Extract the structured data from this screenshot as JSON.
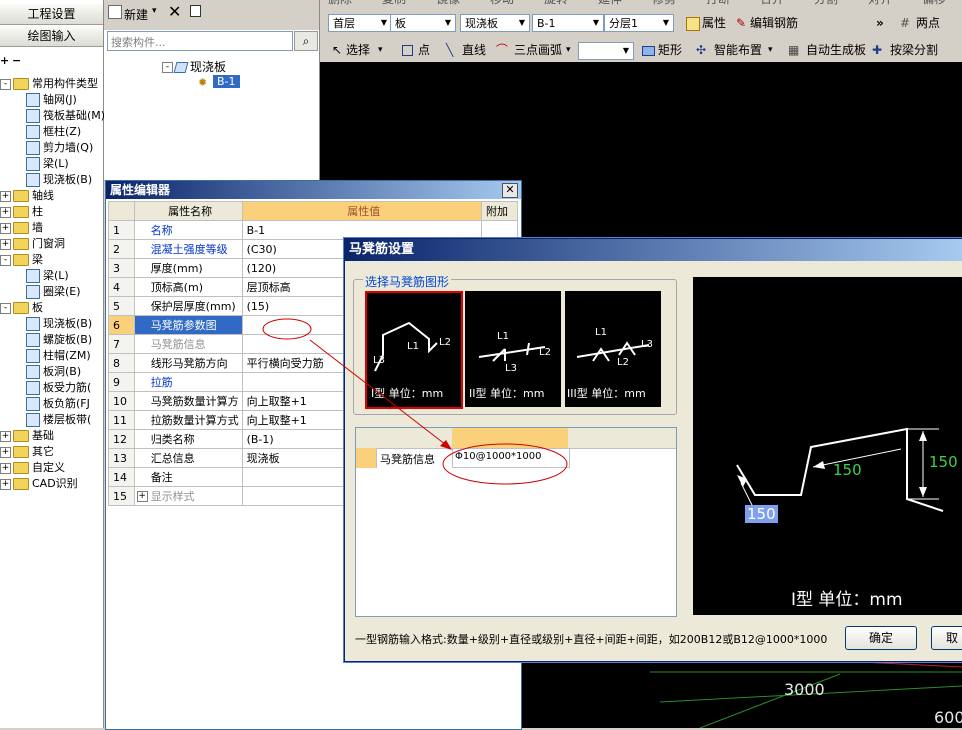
{
  "leftnav": {
    "btn_project": "工程设置",
    "btn_draw": "绘图输入",
    "tree": [
      {
        "label": "常用构件类型",
        "level": 0,
        "toggle": "-",
        "kind": "folder-open"
      },
      {
        "label": "轴网(J)",
        "level": 1,
        "kind": "grid-icon"
      },
      {
        "label": "筏板基础(M)",
        "level": 1,
        "kind": "raft-icon"
      },
      {
        "label": "框柱(Z)",
        "level": 1,
        "kind": "column-icon"
      },
      {
        "label": "剪力墙(Q)",
        "level": 1,
        "kind": "wall-icon"
      },
      {
        "label": "梁(L)",
        "level": 1,
        "kind": "beam-icon"
      },
      {
        "label": "现浇板(B)",
        "level": 1,
        "kind": "slab-icon"
      },
      {
        "label": "轴线",
        "level": 0,
        "toggle": "+",
        "kind": "folder"
      },
      {
        "label": "柱",
        "level": 0,
        "toggle": "+",
        "kind": "folder"
      },
      {
        "label": "墙",
        "level": 0,
        "toggle": "+",
        "kind": "folder"
      },
      {
        "label": "门窗洞",
        "level": 0,
        "toggle": "+",
        "kind": "folder"
      },
      {
        "label": "梁",
        "level": 0,
        "toggle": "-",
        "kind": "folder-open"
      },
      {
        "label": "梁(L)",
        "level": 1,
        "kind": "beam-icon"
      },
      {
        "label": "圈梁(E)",
        "level": 1,
        "kind": "ring-beam-icon"
      },
      {
        "label": "板",
        "level": 0,
        "toggle": "-",
        "kind": "folder-open"
      },
      {
        "label": "现浇板(B)",
        "level": 1,
        "kind": "slab-icon"
      },
      {
        "label": "螺旋板(B)",
        "level": 1,
        "kind": "spiral-slab-icon"
      },
      {
        "label": "柱帽(ZM)",
        "level": 1,
        "kind": "column-cap-icon"
      },
      {
        "label": "板洞(B)",
        "level": 1,
        "kind": "slab-hole-icon"
      },
      {
        "label": "板受力筋(",
        "level": 1,
        "kind": "rebar-icon"
      },
      {
        "label": "板负筋(FJ",
        "level": 1,
        "kind": "neg-rebar-icon"
      },
      {
        "label": "楼层板带(",
        "level": 1,
        "kind": "strip-icon"
      },
      {
        "label": "基础",
        "level": 0,
        "toggle": "+",
        "kind": "folder"
      },
      {
        "label": "其它",
        "level": 0,
        "toggle": "+",
        "kind": "folder"
      },
      {
        "label": "自定义",
        "level": 0,
        "toggle": "+",
        "kind": "folder"
      },
      {
        "label": "CAD识别",
        "level": 0,
        "toggle": "+",
        "kind": "folder"
      }
    ]
  },
  "complist": {
    "new_label": "新建",
    "search_placeholder": "搜索构件...",
    "tree_root": "现浇板",
    "tree_child": "B-1"
  },
  "toolbar": {
    "row0": [
      "删除",
      "复制",
      "镜像",
      "移动",
      "旋转",
      "延伸",
      "修剪",
      "打断",
      "合并",
      "分割",
      "对齐",
      "偏移"
    ],
    "floor": "首层",
    "cat": "板",
    "type": "现浇板",
    "name": "B-1",
    "layer": "分层1",
    "attr_btn": "属性",
    "edit_rebar_btn": "编辑钢筋",
    "two_point": "两点",
    "select_btn": "选择",
    "point_btn": "点",
    "line_btn": "直线",
    "arc_btn": "三点画弧",
    "rect_btn": "矩形",
    "smart_btn": "智能布置",
    "auto_btn": "自动生成板",
    "split_btn": "按梁分割"
  },
  "canvas": {
    "label_3000": "3000",
    "label_600": "600"
  },
  "propwin": {
    "title": "属性编辑器",
    "col_name": "属性名称",
    "col_value": "属性值",
    "col_extra": "附加",
    "rows": [
      {
        "n": "1",
        "name": "名称",
        "value": "B-1",
        "blue": true
      },
      {
        "n": "2",
        "name": "混凝土强度等级",
        "value": "(C30)",
        "blue": true
      },
      {
        "n": "3",
        "name": "厚度(mm)",
        "value": "(120)",
        "blue": false
      },
      {
        "n": "4",
        "name": "顶标高(m)",
        "value": "层顶标高",
        "blue": false
      },
      {
        "n": "5",
        "name": "保护层厚度(mm)",
        "value": "(15)",
        "blue": false
      },
      {
        "n": "6",
        "name": "马凳筋参数图",
        "value": "",
        "blue": false,
        "selected": true
      },
      {
        "n": "7",
        "name": "马凳筋信息",
        "value": "",
        "blue": false,
        "grey": true
      },
      {
        "n": "8",
        "name": "线形马凳筋方向",
        "value": "平行横向受力筋",
        "blue": false
      },
      {
        "n": "9",
        "name": "拉筋",
        "value": "",
        "blue": true
      },
      {
        "n": "10",
        "name": "马凳筋数量计算方",
        "value": "向上取整+1",
        "blue": false
      },
      {
        "n": "11",
        "name": "拉筋数量计算方式",
        "value": "向上取整+1",
        "blue": false
      },
      {
        "n": "12",
        "name": "归类名称",
        "value": "(B-1)",
        "blue": false
      },
      {
        "n": "13",
        "name": "汇总信息",
        "value": "现浇板",
        "blue": false
      },
      {
        "n": "14",
        "name": "备注",
        "value": "",
        "blue": false
      },
      {
        "n": "15",
        "name": "显示样式",
        "value": "",
        "blue": false,
        "grey": true,
        "expander": "+"
      }
    ]
  },
  "dialog": {
    "title": "马凳筋设置",
    "group_label": "选择马凳筋图形",
    "shapes": [
      {
        "caption": "I型 单位：mm",
        "labels": [
          "L1",
          "L2",
          "L3"
        ]
      },
      {
        "caption": "II型 单位：mm",
        "labels": [
          "L1",
          "L2",
          "L3"
        ]
      },
      {
        "caption": "III型 单位：mm",
        "labels": [
          "L1",
          "L2",
          "L3"
        ]
      }
    ],
    "info_label": "马凳筋信息",
    "info_value": "Φ10@1000*1000",
    "preview": {
      "dim1": "150",
      "dim2": "150",
      "dim3": "150",
      "caption": "I型 单位：mm"
    },
    "hint": "一型钢筋输入格式:数量+级别+直径或级别+直径+间距+间距，如200B12或B12@1000*1000",
    "ok": "确定",
    "cancel": "取"
  },
  "colors": {
    "accent_red": "#d00000",
    "selection_blue": "#316ac5",
    "dim_green": "#3cd24b"
  }
}
